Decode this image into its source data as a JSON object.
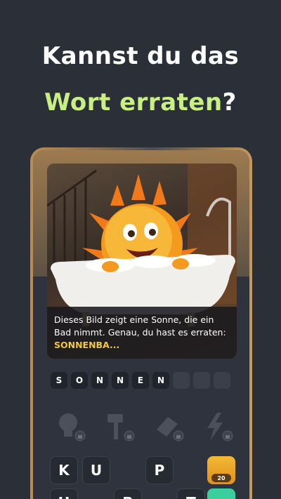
{
  "headline": {
    "line1": "Kannst du das",
    "line2_accent": "Wort erraten",
    "line2_suffix": "?"
  },
  "caption": {
    "text": "Dieses Bild zeigt eine Sonne, die ein Bad nimmt. Genau, du hast es erraten:",
    "answer": "SONNENBA..."
  },
  "letters": [
    "S",
    "O",
    "N",
    "N",
    "E",
    "N",
    "",
    "",
    ""
  ],
  "tools": [
    {
      "name": "lightbulb-icon",
      "locked": true
    },
    {
      "name": "hammer-icon",
      "locked": true
    },
    {
      "name": "eraser-icon",
      "locked": true
    },
    {
      "name": "lightning-icon",
      "locked": true
    }
  ],
  "keyboard": {
    "row1": [
      "K",
      "U",
      "P"
    ],
    "row2": [
      "H",
      "B",
      "T"
    ]
  },
  "coin_button": {
    "badge": "20"
  },
  "colors": {
    "background": "#2a2f38",
    "accent": "#c9ef84",
    "answer": "#f3c83a",
    "coin": "#f3b935"
  }
}
